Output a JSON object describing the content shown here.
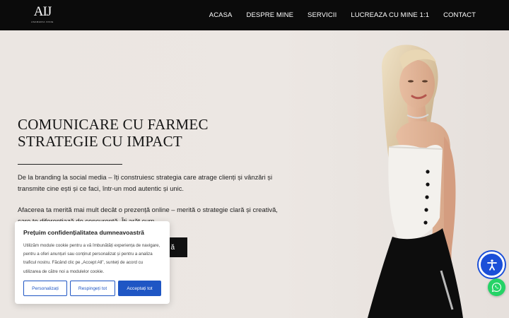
{
  "header": {
    "logo_mark": "AIJ",
    "logo_sub": "ANAMARIA IONIE",
    "nav": [
      "ACASA",
      "DESPRE MINE",
      "SERVICII",
      "LUCREAZA CU MINE 1:1",
      "CONTACT"
    ]
  },
  "hero": {
    "title_line1": "COMUNICARE CU FARMEC",
    "title_line2": "STRATEGIE CU IMPACT",
    "paragraph1": "De la branding la social media – îți construiesc strategia care atrage clienți și vânzări și transmite cine ești și ce faci, într-un mod autentic și unic.",
    "paragraph2": "Afacerea ta merită mai mult decât o prezență online – merită o strategie clară și creativă, care te diferențiază de concurență. Îți arăt cum.",
    "cta_label": "ă"
  },
  "cookie": {
    "title": "Prețuim confidențialitatea dumneavoastră",
    "text": "Utilizăm module cookie pentru a vă îmbunătăți experiența de navigare, pentru a oferi anunțuri sau conținut personalizat și pentru a analiza traficul nostru. Făcând clic pe „Accept All”, sunteți de acord cu utilizarea de către noi a modulelor cookie.",
    "customize_label": "Personalizați",
    "reject_label": "Respingeți tot",
    "accept_label": "Acceptați tot"
  },
  "icons": {
    "accessibility": "accessibility-icon",
    "whatsapp": "whatsapp-icon"
  },
  "colors": {
    "header_bg": "#0b0b0b",
    "hero_bg": "#ece7e3",
    "cookie_accent": "#1f56c4",
    "a11y_blue": "#1b4fd8",
    "whatsapp_green": "#25d366"
  }
}
